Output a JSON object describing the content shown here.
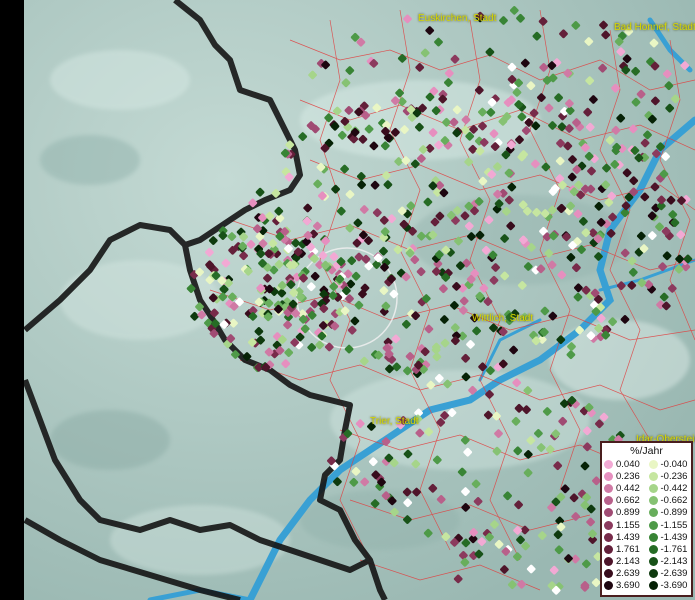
{
  "map": {
    "cities": [
      {
        "name": "Euskirchen, Stadt"
      },
      {
        "name": "Bad Honnef, Stadt"
      },
      {
        "name": "Wittlich, Stadt"
      },
      {
        "name": "Trier, Stadt"
      },
      {
        "name": "Idar-Oberstein, Stadt"
      }
    ],
    "colors": {
      "hillshade": "#a9c4bf",
      "water": "#39a0d4",
      "admin_lines": "#e04040",
      "border": "#111111"
    }
  },
  "legend": {
    "title": "%/Jahr",
    "positive": [
      {
        "label": "0.040",
        "color": "#f2a9d4"
      },
      {
        "label": "0.236",
        "color": "#e68fbf"
      },
      {
        "label": "0.442",
        "color": "#d07aa5"
      },
      {
        "label": "0.662",
        "color": "#b8608a"
      },
      {
        "label": "0.899",
        "color": "#a04b73"
      },
      {
        "label": "1.155",
        "color": "#8c3a5e"
      },
      {
        "label": "1.439",
        "color": "#782b4a"
      },
      {
        "label": "1.761",
        "color": "#64203a"
      },
      {
        "label": "2.143",
        "color": "#4e152a"
      },
      {
        "label": "2.639",
        "color": "#380c1c"
      },
      {
        "label": "3.690",
        "color": "#1e0610"
      }
    ],
    "negative": [
      {
        "label": "-0.040",
        "color": "#e9f6c4"
      },
      {
        "label": "-0.236",
        "color": "#c6e6a0"
      },
      {
        "label": "-0.442",
        "color": "#a6d58a"
      },
      {
        "label": "-0.662",
        "color": "#86c273"
      },
      {
        "label": "-0.899",
        "color": "#68ae5c"
      },
      {
        "label": "-1.155",
        "color": "#4e9a48"
      },
      {
        "label": "-1.439",
        "color": "#388435"
      },
      {
        "label": "-1.761",
        "color": "#266c25"
      },
      {
        "label": "-2.143",
        "color": "#185218"
      },
      {
        "label": "-2.639",
        "color": "#0e3a0e"
      },
      {
        "label": "-3.690",
        "color": "#062206"
      }
    ]
  }
}
